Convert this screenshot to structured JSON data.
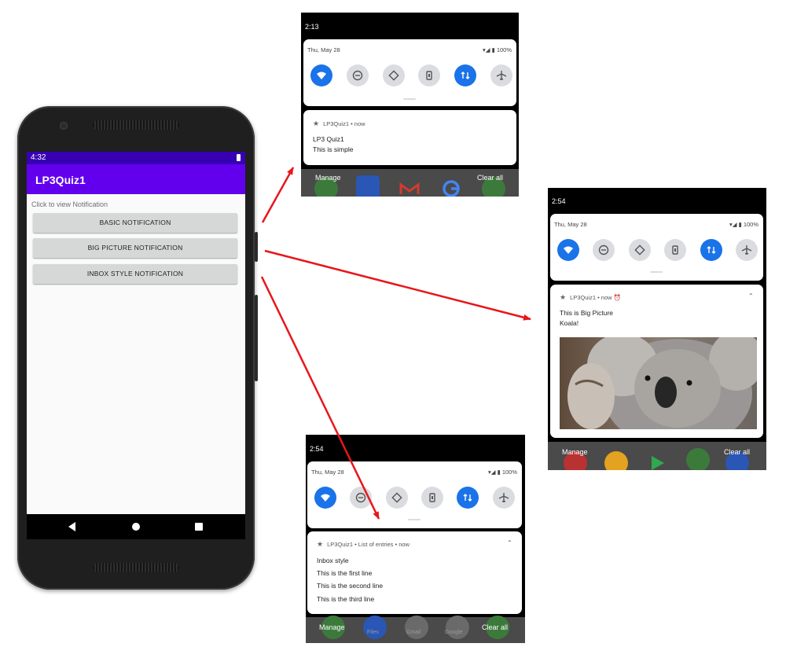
{
  "phone": {
    "status_time": "4:32",
    "app_title": "LP3Quiz1",
    "hint": "Click to view Notification",
    "buttons": [
      "BASIC NOTIFICATION",
      "BIG PICTURE NOTIFICATION",
      "INBOX STYLE NOTIFICATION"
    ],
    "colors": {
      "status_bar": "#3700b3",
      "app_bar": "#6200ee"
    }
  },
  "shade_basic": {
    "time": "2:13",
    "date": "Thu, May 28",
    "battery": "100%",
    "header": "LP3Quiz1 • now",
    "title": "LP3 Quiz1",
    "text": "This is simple",
    "manage": "Manage",
    "clear": "Clear all"
  },
  "shade_bigpicture": {
    "time": "2:54",
    "date": "Thu, May 28",
    "battery": "100%",
    "header": "LP3Quiz1 • now",
    "title": "This is Big Picture",
    "text": "Koala!",
    "manage": "Manage",
    "clear": "Clear all"
  },
  "shade_inbox": {
    "time": "2:54",
    "date": "Thu, May 28",
    "battery": "100%",
    "header": "LP3Quiz1 • List of entries • now",
    "title": "Inbox style",
    "lines": [
      "This is the first line",
      "This is the second line",
      "This is the third line"
    ],
    "manage": "Manage",
    "clear": "Clear all",
    "dock_labels": [
      "Files",
      "Gmail",
      "Google"
    ]
  },
  "quick_tiles": [
    "wifi-icon",
    "dnd-icon",
    "autorotate-icon",
    "battery-saver-icon",
    "mobile-data-icon",
    "airplane-icon"
  ],
  "accent_color": "#1a73e8",
  "arrow_color": "#e8161b"
}
